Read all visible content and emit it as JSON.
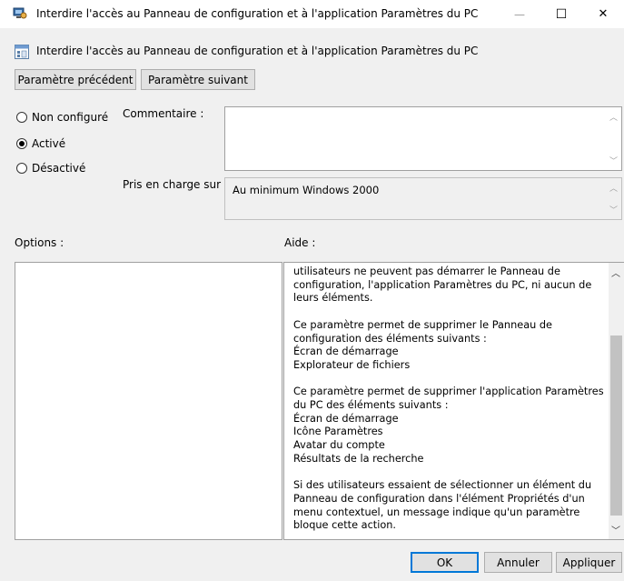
{
  "window": {
    "title": "Interdire l'accès au Panneau de configuration et à l'application Paramètres du PC"
  },
  "header": {
    "policy_title": "Interdire l'accès au Panneau de configuration et à l'application Paramètres du PC"
  },
  "nav": {
    "prev_label": "Paramètre précédent",
    "next_label": "Paramètre suivant"
  },
  "state": {
    "options": [
      {
        "label": "Non configuré",
        "selected": false
      },
      {
        "label": "Activé",
        "selected": true
      },
      {
        "label": "Désactivé",
        "selected": false
      }
    ]
  },
  "comment": {
    "label": "Commentaire :",
    "value": ""
  },
  "supported": {
    "label": "Pris en charge sur :",
    "value": "Au minimum Windows 2000"
  },
  "options_section": {
    "label": "Options :"
  },
  "help_section": {
    "label": "Aide :",
    "paragraphs": [
      "utilisateurs ne peuvent pas démarrer le Panneau de configuration, l'application Paramètres du PC, ni aucun de leurs éléments.",
      "Ce paramètre permet de supprimer le Panneau de configuration des éléments suivants :\nÉcran de démarrage\nExplorateur de fichiers",
      "Ce paramètre permet de supprimer l'application Paramètres du PC des éléments suivants :\nÉcran de démarrage\nIcône Paramètres\nAvatar du compte\nRésultats de la recherche",
      "Si des utilisateurs essaient de sélectionner un élément du Panneau de configuration dans l'élément Propriétés d'un menu contextuel, un message indique qu'un paramètre bloque cette action."
    ]
  },
  "footer": {
    "ok_label": "OK",
    "cancel_label": "Annuler",
    "apply_label": "Appliquer"
  },
  "window_controls": {
    "minimize": "—",
    "maximize": "☐",
    "close": "✕"
  },
  "colors": {
    "accent": "#0078d7",
    "window_bg": "#f0f0f0"
  }
}
